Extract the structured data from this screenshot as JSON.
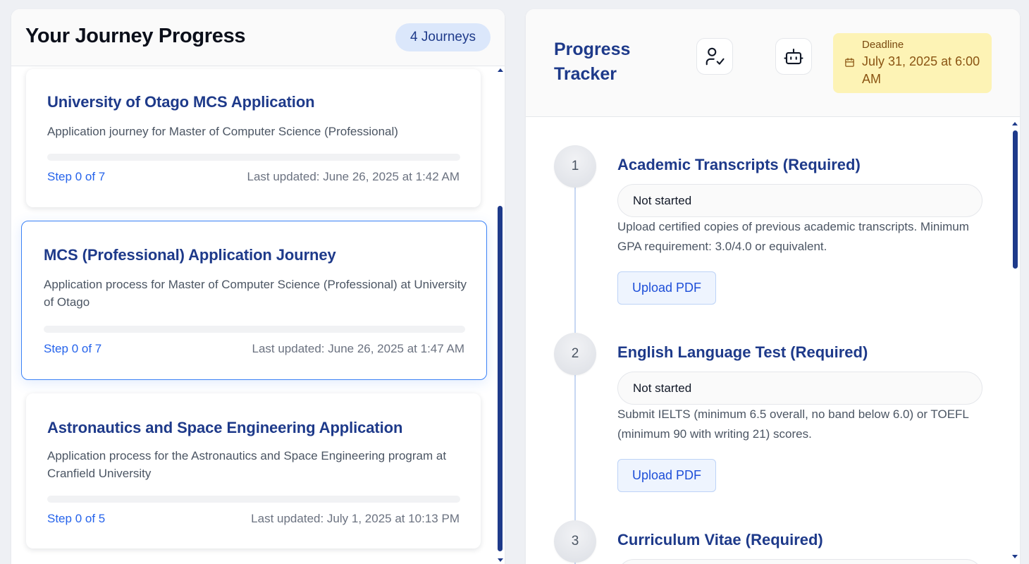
{
  "journeys_panel": {
    "title": "Your Journey Progress",
    "count_badge": "4 Journeys",
    "cards": [
      {
        "title": "University of Otago MCS Application",
        "description": "Application journey for Master of Computer Science (Professional)",
        "progress": 0,
        "step": "Step 0 of 7",
        "updated": "Last updated: June 26, 2025 at 1:42 AM"
      },
      {
        "title": "MCS (Professional) Application Journey",
        "description": "Application process for Master of Computer Science (Professional) at University of Otago",
        "progress": 0,
        "step": "Step 0 of 7",
        "updated": "Last updated: June 26, 2025 at 1:47 AM"
      },
      {
        "title": "Astronautics and Space Engineering Application",
        "description": "Application process for the Astronautics and Space Engineering program at Cranfield University",
        "progress": 0,
        "step": "Step 0 of 5",
        "updated": "Last updated: July 1, 2025 at 10:13 PM"
      }
    ]
  },
  "tracker": {
    "title": "Progress Tracker",
    "icons": [
      "user-check-icon",
      "robot-icon"
    ],
    "deadline_label": "Deadline",
    "deadline_value": "July 31, 2025 at 6:00 AM",
    "steps": [
      {
        "number": "1",
        "title": "Academic Transcripts (Required)",
        "status": "Not started",
        "description": "Upload certified copies of previous academic transcripts. Minimum GPA requirement: 3.0/4.0 or equivalent.",
        "button": "Upload PDF"
      },
      {
        "number": "2",
        "title": "English Language Test (Required)",
        "status": "Not started",
        "description": "Submit IELTS (minimum 6.5 overall, no band below 6.0) or TOEFL (minimum 90 with writing 21) scores.",
        "button": "Upload PDF"
      },
      {
        "number": "3",
        "title": "Curriculum Vitae (Required)"
      }
    ]
  },
  "colors": {
    "accent": "#1e3a8a",
    "link": "#2563eb",
    "deadline_bg": "#fdf3b5",
    "badge_bg": "#dbe7fb"
  }
}
